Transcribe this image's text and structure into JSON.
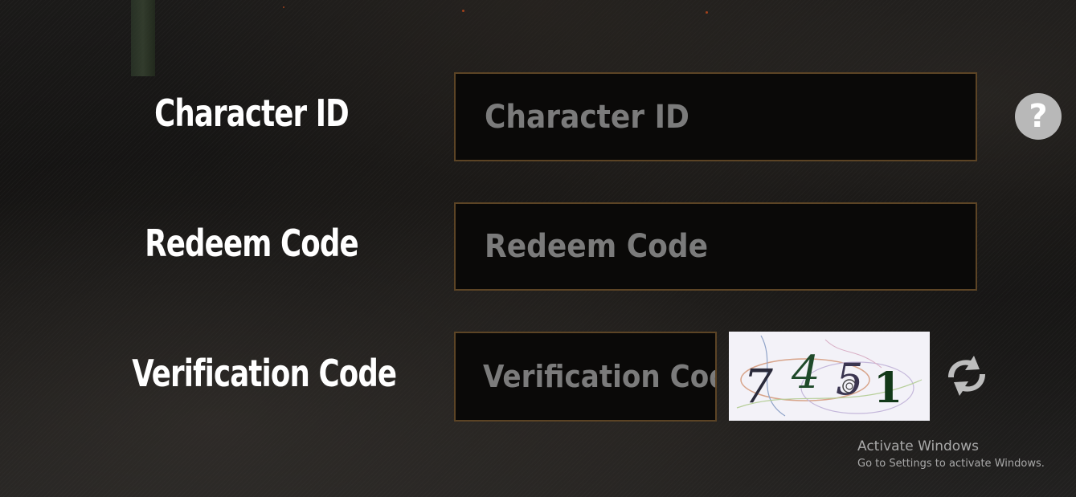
{
  "form": {
    "character_id": {
      "label": "Character ID",
      "placeholder": "Character ID",
      "value": ""
    },
    "redeem_code": {
      "label": "Redeem Code",
      "placeholder": "Redeem Code",
      "value": ""
    },
    "verification_code": {
      "label": "Verification Code",
      "placeholder": "Verification Code",
      "value": ""
    },
    "help_button": {
      "icon": "question-mark-icon",
      "glyph": "?"
    },
    "captcha": {
      "characters": [
        "7",
        "4",
        "5",
        "1"
      ]
    },
    "refresh_button": {
      "icon": "refresh-arrows-icon"
    }
  },
  "watermark": {
    "title": "Activate Windows",
    "subtitle": "Go to Settings to activate Windows."
  },
  "colors": {
    "field_border": "#5c4425",
    "field_background": "#0a0908",
    "placeholder_text": "#7b7b7b",
    "label_text": "#ffffff",
    "help_button_bg": "#b8b8b8",
    "refresh_icon": "#bdbdbd"
  }
}
